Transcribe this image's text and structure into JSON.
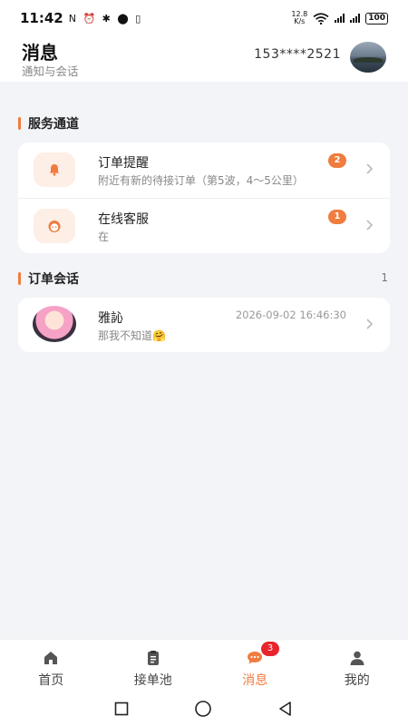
{
  "status_bar": {
    "time": "11:42",
    "icons": "N ⏰ ✱ ⬤ ▯",
    "net_speed_top": "12.8",
    "net_speed_bottom": "K/s",
    "battery": "100"
  },
  "header": {
    "title": "消息",
    "subtitle": "通知与会话",
    "phone": "153****2521"
  },
  "service_section": {
    "title": "服务通道",
    "items": [
      {
        "title": "订单提醒",
        "desc": "附近有新的待接订单（第5波，4～5公里）",
        "badge": "2",
        "icon": "bell-icon"
      },
      {
        "title": "在线客服",
        "desc": "在",
        "badge": "1",
        "icon": "customer-service-icon"
      }
    ]
  },
  "order_section": {
    "title": "订单会话",
    "count": "1",
    "conversations": [
      {
        "name": "雅訫",
        "time": "2026-09-02 16:46:30",
        "message": "那我不知道🤗"
      }
    ]
  },
  "bottom_nav": {
    "items": [
      {
        "label": "首页",
        "icon": "home-icon"
      },
      {
        "label": "接单池",
        "icon": "clipboard-icon"
      },
      {
        "label": "消息",
        "icon": "chat-icon",
        "badge": "3",
        "active": true
      },
      {
        "label": "我的",
        "icon": "profile-icon"
      }
    ]
  },
  "colors": {
    "accent": "#f07c3e",
    "badge_red": "#e8252c",
    "background": "#f3f4f8"
  }
}
